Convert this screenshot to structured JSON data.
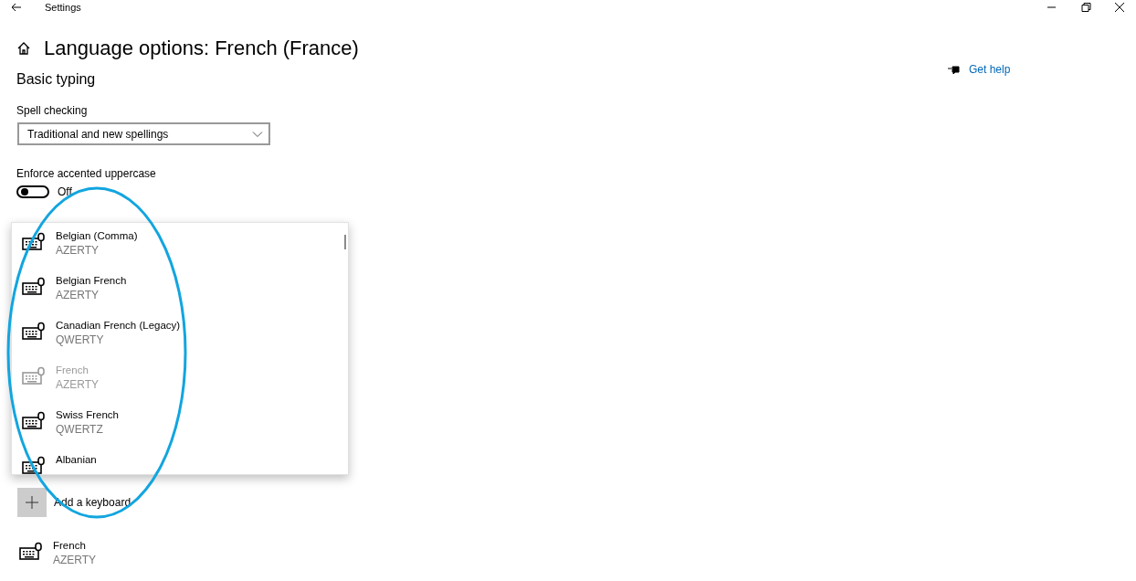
{
  "window": {
    "title": "Settings"
  },
  "page": {
    "title": "Language options: French (France)",
    "help_link": "Get help"
  },
  "section": {
    "heading": "Basic typing"
  },
  "spell_checking": {
    "label": "Spell checking",
    "value": "Traditional and new spellings"
  },
  "accented_uppercase": {
    "label": "Enforce accented uppercase",
    "on": false,
    "state_text": "Off"
  },
  "keyboard_menu": {
    "items": [
      {
        "name": "Belgian (Comma)",
        "layout": "AZERTY",
        "disabled": false
      },
      {
        "name": "Belgian French",
        "layout": "AZERTY",
        "disabled": false
      },
      {
        "name": "Canadian French (Legacy)",
        "layout": "QWERTY",
        "disabled": false
      },
      {
        "name": "French",
        "layout": "AZERTY",
        "disabled": true
      },
      {
        "name": "Swiss French",
        "layout": "QWERTZ",
        "disabled": false
      },
      {
        "name": "Albanian",
        "disabled": false
      }
    ]
  },
  "add_keyboard": {
    "label": "Add a keyboard"
  },
  "keyboards": [
    {
      "name": "French",
      "layout": "AZERTY"
    }
  ]
}
